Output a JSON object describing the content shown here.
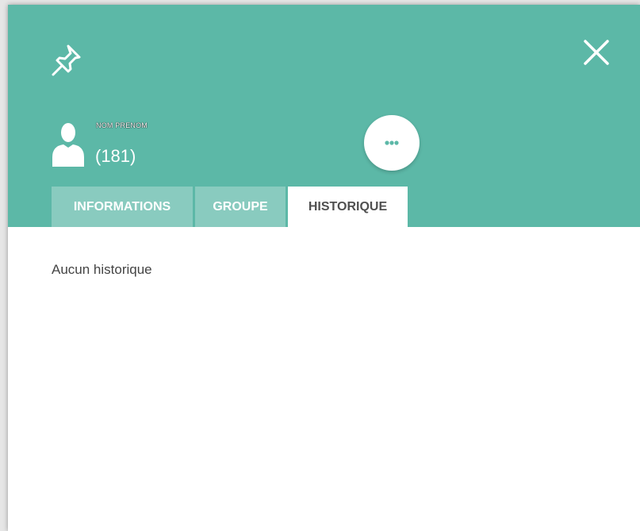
{
  "header": {
    "pin_icon": "pin-icon",
    "close_icon": "close-icon",
    "more_icon": "ellipsis-icon",
    "avatar_icon": "user-icon",
    "background_color": "#5cb8a7"
  },
  "user": {
    "name": "NOM PRENOM",
    "count": "(181)"
  },
  "tabs": [
    {
      "label": "INFORMATIONS",
      "active": false
    },
    {
      "label": "GROUPE",
      "active": false
    },
    {
      "label": "HISTORIQUE",
      "active": true
    }
  ],
  "content": {
    "empty_message": "Aucun historique"
  }
}
